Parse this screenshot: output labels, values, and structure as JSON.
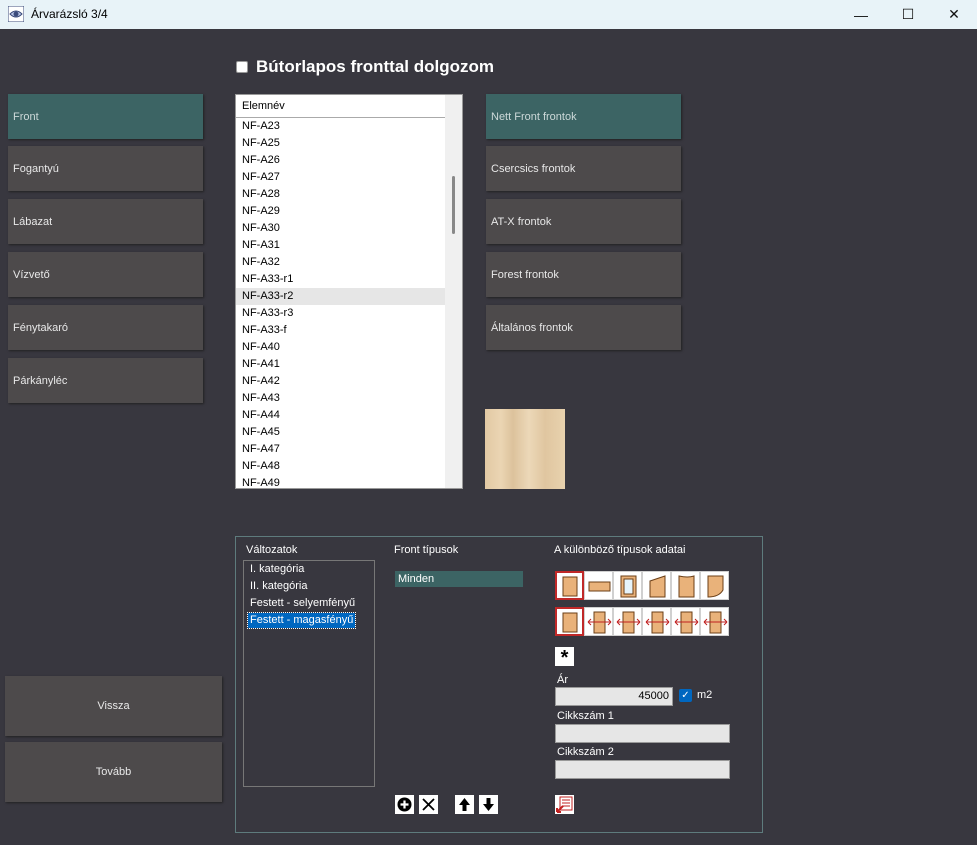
{
  "window": {
    "title": "Árvarázsló 3/4",
    "minimize": "—",
    "maximize": "☐",
    "close": "✕"
  },
  "main_checkbox_label": "Bútorlapos fronttal dolgozom",
  "categories": [
    "Front",
    "Fogantyú",
    "Lábazat",
    "Vízvető",
    "Fénytakaró",
    "Párkányléc"
  ],
  "list": {
    "header": "Elemnév",
    "items": [
      "NF-A23",
      "NF-A25",
      "NF-A26",
      "NF-A27",
      "NF-A28",
      "NF-A29",
      "NF-A30",
      "NF-A31",
      "NF-A32",
      "NF-A33-r1",
      "NF-A33-r2",
      "NF-A33-r3",
      "NF-A33-f",
      "NF-A40",
      "NF-A41",
      "NF-A42",
      "NF-A43",
      "NF-A44",
      "NF-A45",
      "NF-A47",
      "NF-A48",
      "NF-A49"
    ],
    "selected": "NF-A33-r2"
  },
  "front_groups": [
    "Nett Front frontok",
    "Csercsics frontok",
    "AT-X frontok",
    "Forest frontok",
    "Általános frontok"
  ],
  "nav": {
    "back": "Vissza",
    "next": "Tovább"
  },
  "variants": {
    "label": "Változatok",
    "items": [
      "I. kategória",
      "II. kategória",
      "Festett - selyemfényű",
      "Festett - magasfényű"
    ],
    "selected": "Festett - magasfényű"
  },
  "front_types": {
    "label": "Front típusok",
    "items": [
      "Minden"
    ]
  },
  "type_data": {
    "label": "A különböző típusok adatai",
    "price_label": "Ár",
    "price_value": "45000",
    "m2_label": "m2",
    "m2_checked": true,
    "sku1_label": "Cikkszám 1",
    "sku1_value": "",
    "sku2_label": "Cikkszám 2",
    "sku2_value": ""
  },
  "colors": {
    "background": "#38373f",
    "button": "#4d4a4b",
    "active": "#3c6464",
    "selection": "#0067c0"
  }
}
